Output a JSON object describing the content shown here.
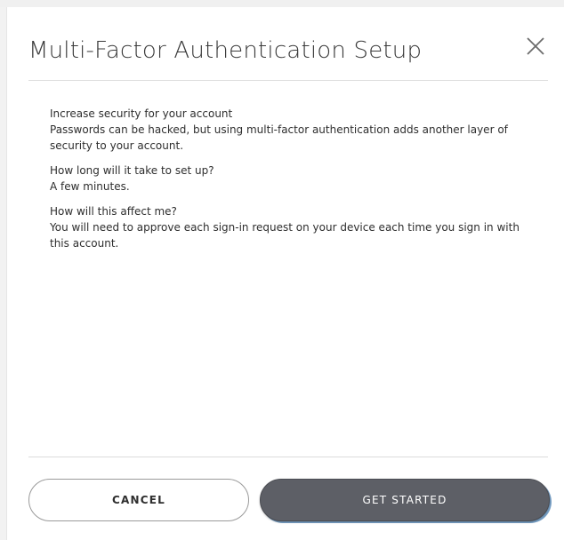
{
  "dialog": {
    "title": "Multi-Factor Authentication Setup",
    "close_icon": "close-icon",
    "sections": [
      {
        "heading": "Increase security for your account",
        "text": "Passwords can be hacked, but using multi-factor authentication adds another layer of security to your account."
      },
      {
        "heading": "How long will it take to set up?",
        "text": "A few minutes."
      },
      {
        "heading": "How will this affect me?",
        "text": "You will need to approve each sign-in request on your device each time you sign in with this account."
      }
    ],
    "buttons": {
      "cancel_label": "CANCEL",
      "primary_label": "GET STARTED"
    }
  },
  "colors": {
    "primary_button": "#5d5f66",
    "title_text": "#3a3a3a",
    "divider": "#dcdcdc"
  }
}
